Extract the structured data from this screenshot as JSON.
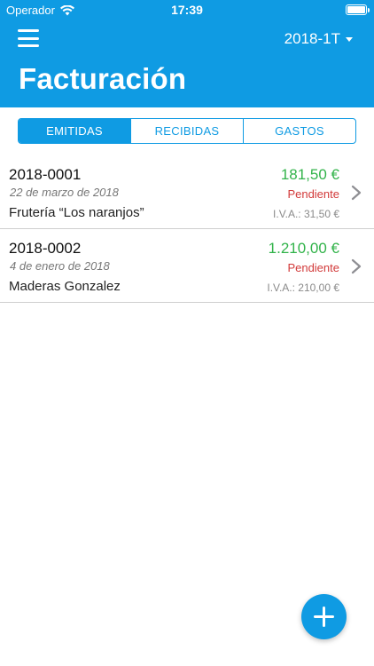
{
  "status_bar": {
    "carrier": "Operador",
    "time": "17:39",
    "wifi_icon": "wifi-icon",
    "battery_level": 1.0
  },
  "header": {
    "menu_icon": "hamburger-menu-icon",
    "period": "2018-1T",
    "title": "Facturación",
    "color": "#0f9be3"
  },
  "tabs": [
    {
      "label": "EMITIDAS",
      "active": true
    },
    {
      "label": "RECIBIDAS",
      "active": false
    },
    {
      "label": "GASTOS",
      "active": false
    }
  ],
  "invoices": [
    {
      "number": "2018-0001",
      "date": "22 de marzo de 2018",
      "client": "Frutería “Los naranjos”",
      "amount": "181,50 €",
      "status": "Pendiente",
      "vat": "I.V.A.: 31,50 €"
    },
    {
      "number": "2018-0002",
      "date": "4 de enero de 2018",
      "client": "Maderas Gonzalez",
      "amount": "1.210,00 €",
      "status": "Pendiente",
      "vat": "I.V.A.: 210,00 €"
    }
  ],
  "colors": {
    "accent": "#0f9be3",
    "amount": "#32b34a",
    "status_pending": "#d23a3a"
  },
  "fab_icon": "plus-icon"
}
